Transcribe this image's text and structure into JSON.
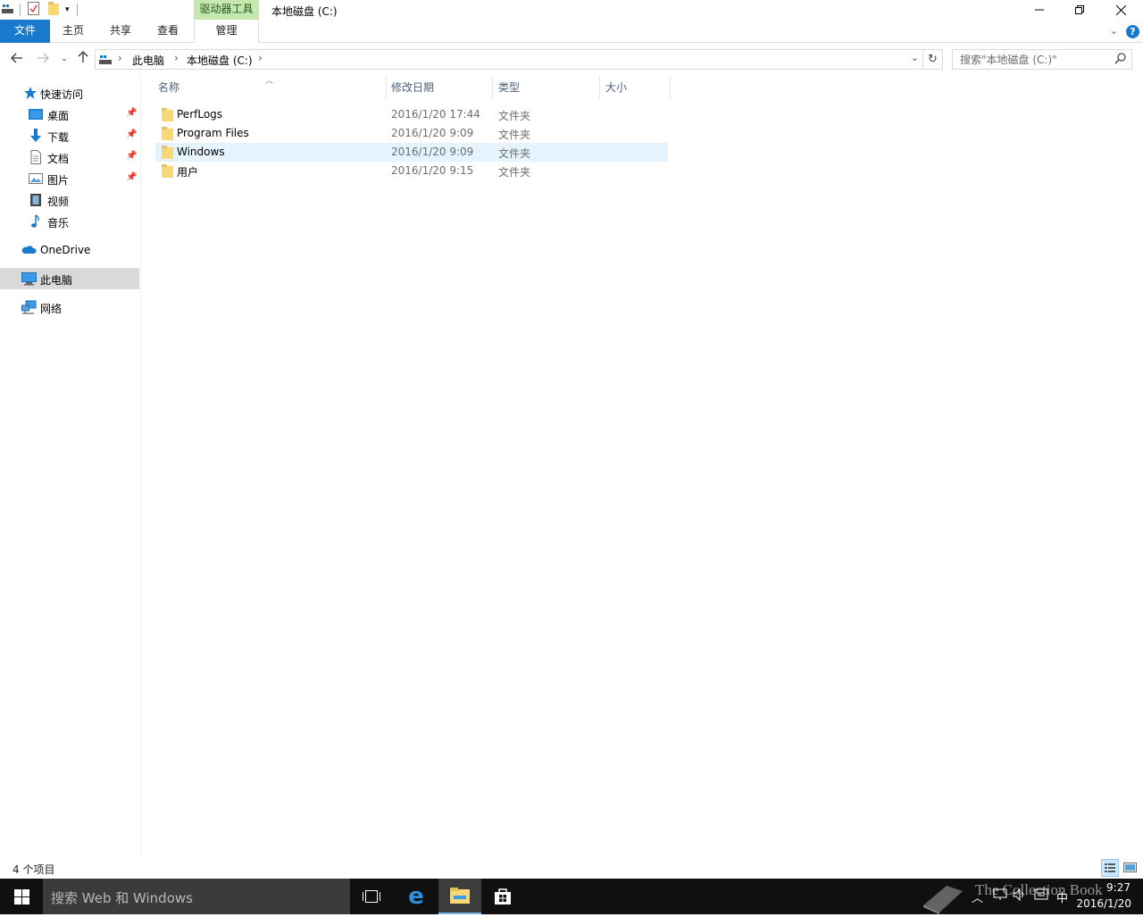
{
  "window": {
    "title": "本地磁盘 (C:)",
    "tool_group": "驱动器工具"
  },
  "ribbon": {
    "tabs": [
      "文件",
      "主页",
      "共享",
      "查看",
      "管理"
    ],
    "help": "?"
  },
  "address": {
    "crumbs": [
      "此电脑",
      "本地磁盘 (C:)"
    ]
  },
  "search": {
    "placeholder": "搜索\"本地磁盘 (C:)\""
  },
  "nav": {
    "quick_access": "快速访问",
    "items": [
      {
        "label": "桌面",
        "icon": "desktop-icon",
        "pinned": true
      },
      {
        "label": "下载",
        "icon": "download-icon",
        "pinned": true
      },
      {
        "label": "文档",
        "icon": "document-icon",
        "pinned": true
      },
      {
        "label": "图片",
        "icon": "picture-icon",
        "pinned": true
      },
      {
        "label": "视频",
        "icon": "video-icon",
        "pinned": false
      },
      {
        "label": "音乐",
        "icon": "music-icon",
        "pinned": false
      }
    ],
    "onedrive": "OneDrive",
    "this_pc": "此电脑",
    "network": "网络"
  },
  "columns": [
    "名称",
    "修改日期",
    "类型",
    "大小"
  ],
  "files": [
    {
      "name": "PerfLogs",
      "date": "2016/1/20 17:44",
      "type": "文件夹"
    },
    {
      "name": "Program Files",
      "date": "2016/1/20 9:09",
      "type": "文件夹"
    },
    {
      "name": "Windows",
      "date": "2016/1/20 9:09",
      "type": "文件夹"
    },
    {
      "name": "用户",
      "date": "2016/1/20 9:15",
      "type": "文件夹"
    }
  ],
  "status": {
    "item_count": "4 个项目"
  },
  "taskbar": {
    "search_text": "搜索 Web 和 Windows",
    "ime": "中",
    "time": "9:27",
    "date": "2016/1/20",
    "watermark": "The Collection Book"
  },
  "colors": {
    "accent": "#1979ca",
    "tool_group": "#c6e7ae",
    "selected_row": "#e5f3ff",
    "taskbar": "#101010"
  }
}
